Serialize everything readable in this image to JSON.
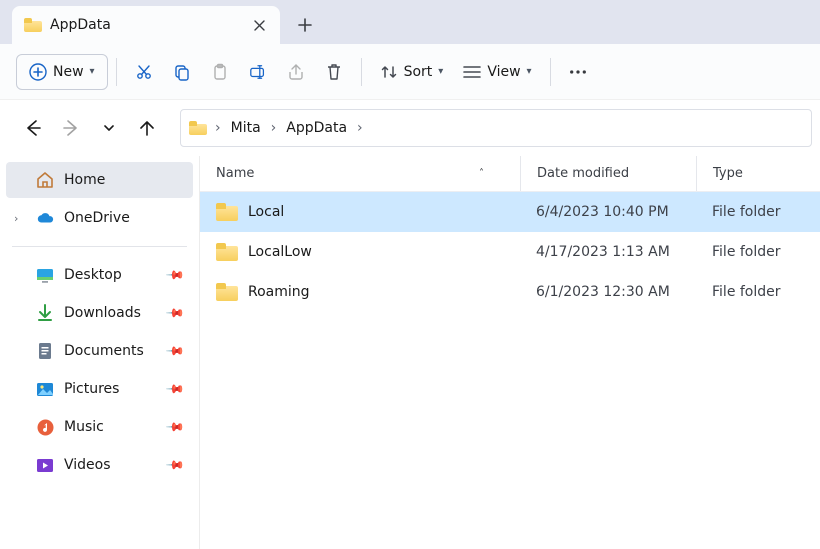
{
  "tab": {
    "title": "AppData"
  },
  "toolbar": {
    "new_label": "New",
    "sort_label": "Sort",
    "view_label": "View"
  },
  "breadcrumb": {
    "segments": [
      "Mita",
      "AppData"
    ]
  },
  "sidebar": {
    "home_label": "Home",
    "onedrive_label": "OneDrive",
    "quick": [
      {
        "label": "Desktop"
      },
      {
        "label": "Downloads"
      },
      {
        "label": "Documents"
      },
      {
        "label": "Pictures"
      },
      {
        "label": "Music"
      },
      {
        "label": "Videos"
      }
    ]
  },
  "columns": {
    "name": "Name",
    "date": "Date modified",
    "type": "Type"
  },
  "rows": [
    {
      "name": "Local",
      "date": "6/4/2023 10:40 PM",
      "type": "File folder",
      "selected": true
    },
    {
      "name": "LocalLow",
      "date": "4/17/2023 1:13 AM",
      "type": "File folder",
      "selected": false
    },
    {
      "name": "Roaming",
      "date": "6/1/2023 12:30 AM",
      "type": "File folder",
      "selected": false
    }
  ]
}
